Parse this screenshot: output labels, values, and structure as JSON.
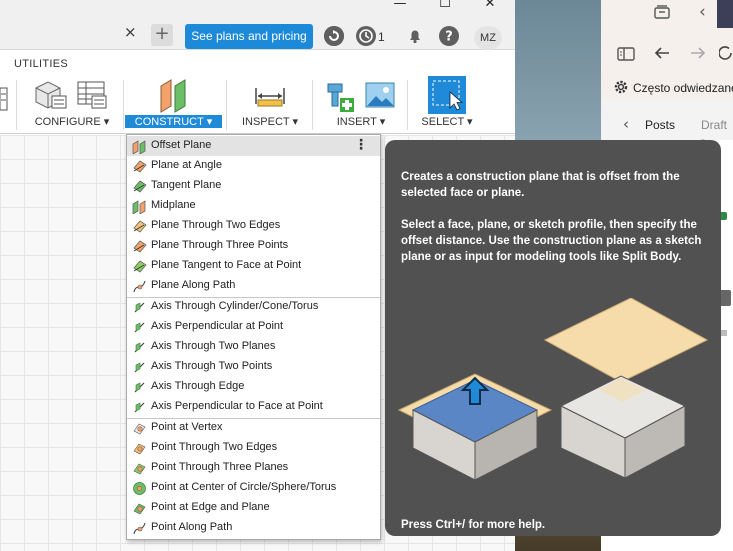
{
  "window": {
    "minimize_glyph": "—",
    "maximize_glyph": "☐",
    "close_glyph": "✕"
  },
  "tabbar": {
    "tab_close_glyph": "×",
    "new_tab_glyph": "+",
    "plans_button": "See plans and pricing",
    "job_count": "1",
    "avatar_initials": "MZ"
  },
  "ribbon": {
    "tab_label": "UTILITIES",
    "groups": {
      "configure": "CONFIGURE ▾",
      "construct": "CONSTRUCT ▾",
      "inspect": "INSPECT ▾",
      "insert": "INSERT ▾",
      "select": "SELECT ▾"
    }
  },
  "menu": {
    "kebab": "⋮",
    "items": [
      {
        "label": "Offset Plane",
        "icon": "offset-plane-icon",
        "highlighted": true
      },
      {
        "label": "Plane at Angle",
        "icon": "plane-at-angle-icon"
      },
      {
        "label": "Tangent Plane",
        "icon": "tangent-plane-icon"
      },
      {
        "label": "Midplane",
        "icon": "midplane-icon"
      },
      {
        "label": "Plane Through Two Edges",
        "icon": "plane-two-edges-icon"
      },
      {
        "label": "Plane Through Three Points",
        "icon": "plane-three-points-icon"
      },
      {
        "label": "Plane Tangent to Face at Point",
        "icon": "plane-tangent-face-icon"
      },
      {
        "label": "Plane Along Path",
        "icon": "plane-along-path-icon"
      },
      {
        "label": "Axis Through Cylinder/Cone/Torus",
        "icon": "axis-cylinder-icon"
      },
      {
        "label": "Axis Perpendicular at Point",
        "icon": "axis-perpendicular-icon"
      },
      {
        "label": "Axis Through Two Planes",
        "icon": "axis-two-planes-icon"
      },
      {
        "label": "Axis Through Two Points",
        "icon": "axis-two-points-icon"
      },
      {
        "label": "Axis Through Edge",
        "icon": "axis-edge-icon"
      },
      {
        "label": "Axis Perpendicular to Face at Point",
        "icon": "axis-perp-face-icon"
      },
      {
        "label": "Point at Vertex",
        "icon": "point-vertex-icon"
      },
      {
        "label": "Point Through Two Edges",
        "icon": "point-two-edges-icon"
      },
      {
        "label": "Point Through Three Planes",
        "icon": "point-three-planes-icon"
      },
      {
        "label": "Point at Center of Circle/Sphere/Torus",
        "icon": "point-center-icon"
      },
      {
        "label": "Point at Edge and Plane",
        "icon": "point-edge-plane-icon"
      },
      {
        "label": "Point Along Path",
        "icon": "point-along-path-icon"
      }
    ]
  },
  "tooltip": {
    "summary": "Creates a construction plane that is offset from the selected face or plane.",
    "detail": "Select a face, plane, or sketch profile, then specify the offset distance. Use the construction plane as a sketch plane or as input for modeling tools like Split Body.",
    "help": "Press Ctrl+/ for more help."
  },
  "browser": {
    "bookmark_label": "Często odwiedzane",
    "posts_label": "Posts",
    "draft_label": "Draft -",
    "back_glyph": "‹"
  },
  "colors": {
    "accent": "#1e8ad8",
    "tooltip_bg": "#515151",
    "plane_fill": "#f6dcaa"
  }
}
